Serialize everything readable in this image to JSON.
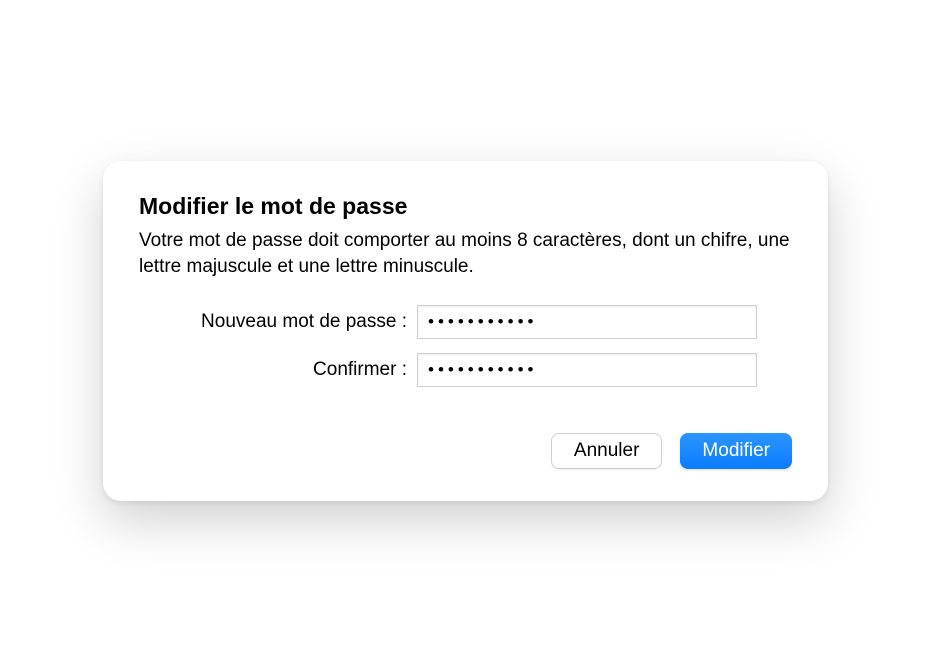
{
  "dialog": {
    "title": "Modifier le mot de passe",
    "description": "Votre mot de passe doit comporter au moins 8 caractères, dont un chifre, une lettre majuscule et une lettre minuscule.",
    "fields": {
      "new_password": {
        "label": "Nouveau mot de passe :",
        "value": "•••••••••••"
      },
      "confirm_password": {
        "label": "Confirmer :",
        "value": "•••••••••••"
      }
    },
    "buttons": {
      "cancel_label": "Annuler",
      "submit_label": "Modifier"
    }
  }
}
